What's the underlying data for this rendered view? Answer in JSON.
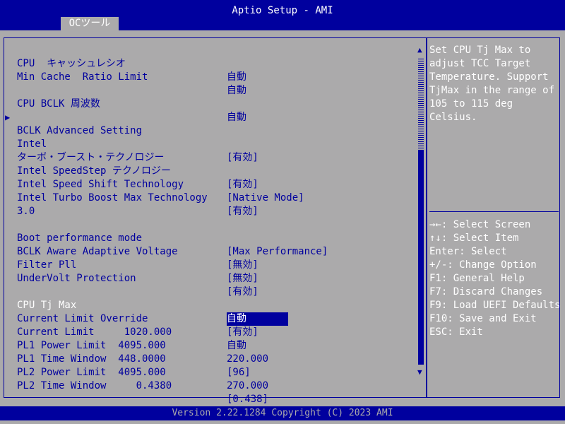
{
  "header": {
    "title": "Aptio Setup - AMI",
    "tab": "OCツール"
  },
  "settings": [
    {
      "label": "CPU  キャッシュレシオ",
      "value": "自動"
    },
    {
      "label": "Min Cache  Ratio Limit",
      "value": "自動"
    },
    {
      "label": "CPU BCLK 周波数",
      "value": "自動"
    },
    {
      "label": "BCLK Advanced Setting",
      "value": ""
    },
    {
      "label": "Intel",
      "value": "[有効]"
    },
    {
      "label": "ターボ・ブースト・テクノロジー",
      "value": ""
    },
    {
      "label": "Intel SpeedStep テクノロジー",
      "value": "[有効]"
    },
    {
      "label": "Intel Speed Shift Technology",
      "value": "[Native Mode]"
    },
    {
      "label": "Intel Turbo Boost Max Technology",
      "value": "[有効]"
    },
    {
      "label": "3.0",
      "value": ""
    },
    {
      "label": "Boot performance mode",
      "value": "[Max Performance]"
    },
    {
      "label": "BCLK Aware Adaptive Voltage",
      "value": "[無効]"
    },
    {
      "label": "Filter Pll",
      "value": "[無効]"
    },
    {
      "label": "UnderVolt Protection",
      "value": "[有効]"
    },
    {
      "label": "CPU Tj Max",
      "value": "自動"
    },
    {
      "label": "Current Limit Override",
      "value": "[有効]"
    },
    {
      "label": "Current Limit     1020.000",
      "value": "自動"
    },
    {
      "label": "PL1 Power Limit  4095.000",
      "value": "220.000"
    },
    {
      "label": "PL1 Time Window  448.0000",
      "value": "[96]"
    },
    {
      "label": "PL2 Power Limit  4095.000",
      "value": "270.000"
    },
    {
      "label": "PL2 Time Window     0.4380",
      "value": "[0.438]"
    }
  ],
  "help": {
    "description": [
      "Set CPU Tj Max to",
      "adjust TCC Target",
      "Temperature. Support",
      "TjMax in the range of",
      "105 to 115 deg",
      "Celsius."
    ],
    "keys": [
      "→←: Select Screen",
      "↑↓: Select Item",
      "Enter: Select",
      "+/-: Change Option",
      "F1: General Help",
      "F7: Discard Changes",
      "F9: Load UEFI Defaults",
      "F10: Save and Exit",
      "ESC: Exit"
    ]
  },
  "footer": {
    "text": "Version 2.22.1284 Copyright (C) 2023 AMI"
  },
  "icons": {
    "submenu_arrow": "▶",
    "scroll_up": "▲",
    "scroll_down": "▼"
  },
  "colors": {
    "frame_blue": "#00009e",
    "background_gray": "#abaaab",
    "text_white": "#ffffff"
  }
}
